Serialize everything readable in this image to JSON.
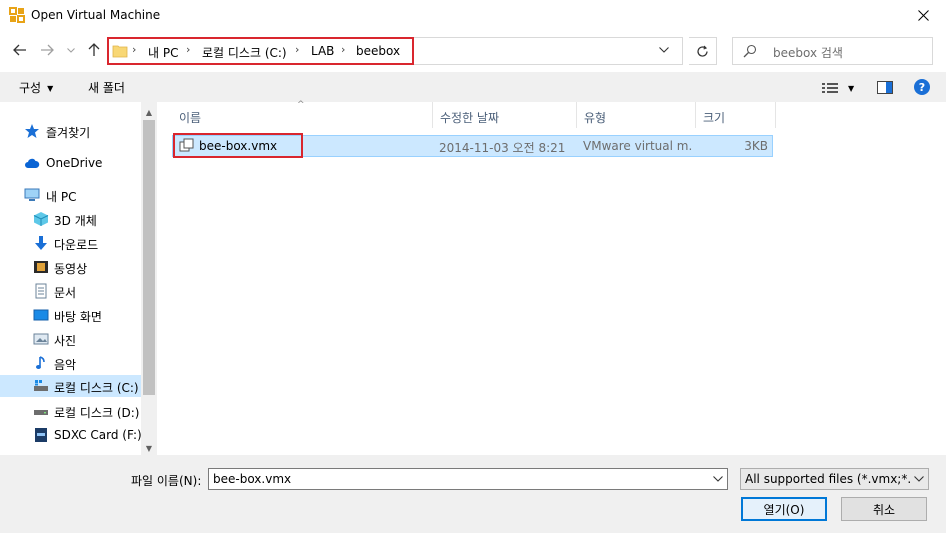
{
  "window": {
    "title": "Open Virtual Machine"
  },
  "address": {
    "crumbs": [
      "내 PC",
      "로컬 디스크 (C:)",
      "LAB",
      "beebox"
    ],
    "separator": "›"
  },
  "search": {
    "placeholder": "beebox 검색"
  },
  "toolbar": {
    "organize": "구성",
    "new_folder": "새 폴더",
    "help": "?"
  },
  "nav": {
    "items": [
      {
        "label": "즐겨찾기",
        "icon": "star-icon"
      },
      {
        "label": "OneDrive",
        "icon": "cloud-icon"
      },
      {
        "label": "내 PC",
        "icon": "computer-icon"
      },
      {
        "label": "3D 개체",
        "icon": "cube-icon"
      },
      {
        "label": "다운로드",
        "icon": "download-icon"
      },
      {
        "label": "동영상",
        "icon": "video-icon"
      },
      {
        "label": "문서",
        "icon": "document-icon"
      },
      {
        "label": "바탕 화면",
        "icon": "desktop-icon"
      },
      {
        "label": "사진",
        "icon": "picture-icon"
      },
      {
        "label": "음악",
        "icon": "music-icon"
      },
      {
        "label": "로컬 디스크 (C:)",
        "icon": "drive-c-icon"
      },
      {
        "label": "로컬 디스크 (D:)",
        "icon": "drive-icon"
      },
      {
        "label": "SDXC Card (F:)",
        "icon": "sdcard-icon"
      }
    ]
  },
  "columns": {
    "name": "이름",
    "date": "수정한 날짜",
    "type": "유형",
    "size": "크기"
  },
  "files": [
    {
      "name": "bee-box.vmx",
      "date": "2014-11-03 오전 8:21",
      "type": "VMware virtual m...",
      "size": "3KB"
    }
  ],
  "footer": {
    "filename_label": "파일 이름(N):",
    "filename_value": "bee-box.vmx",
    "filetype": "All supported files (*.vmx;*.ovf",
    "open": "열기(O)",
    "cancel": "취소"
  },
  "colors": {
    "selection": "#cce8ff",
    "highlight_box": "#d9262e",
    "accent": "#0078d7"
  }
}
